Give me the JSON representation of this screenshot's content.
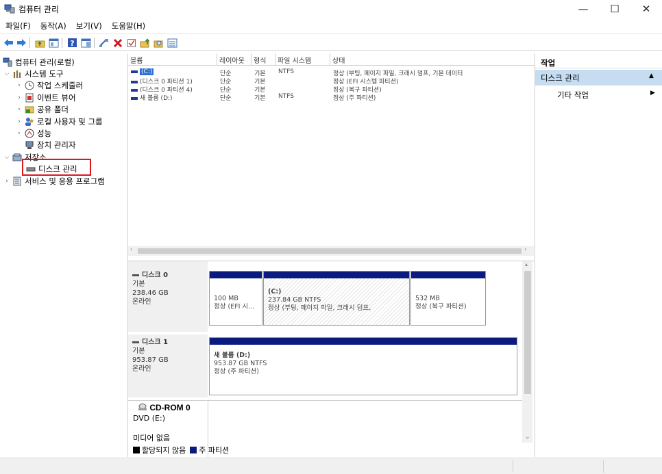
{
  "window": {
    "title": "컴퓨터 관리",
    "controls": {
      "minimize": "—",
      "maximize": "☐",
      "close": "✕"
    }
  },
  "menu": [
    "파일(F)",
    "동작(A)",
    "보기(V)",
    "도움말(H)"
  ],
  "tree": {
    "root": "컴퓨터 관리(로컬)",
    "system_tools": "시스템 도구",
    "task_scheduler": "작업 스케줄러",
    "event_viewer": "이벤트 뷰어",
    "shared_folders": "공유 폴더",
    "local_users": "로컬 사용자 및 그룹",
    "performance": "성능",
    "device_manager": "장치 관리자",
    "storage": "저장소",
    "disk_management": "디스크 관리",
    "services_apps": "서비스 및 응용 프로그램"
  },
  "volume_table": {
    "columns": [
      "볼륨",
      "레이아웃",
      "형식",
      "파일 시스템",
      "상태"
    ],
    "rows": [
      [
        "(C:)",
        "단순",
        "기본",
        "NTFS",
        "정상 (부팅, 페이지 파일, 크래시 덤프, 기본 데이터"
      ],
      [
        "(디스크 0 파티션 1)",
        "단순",
        "기본",
        "",
        "정상 (EFI 시스템 파티션)"
      ],
      [
        "(디스크 0 파티션 4)",
        "단순",
        "기본",
        "",
        "정상 (복구 파티션)"
      ],
      [
        "새 볼륨 (D:)",
        "단순",
        "기본",
        "NTFS",
        "정상 (주 파티션)"
      ]
    ]
  },
  "disks": {
    "disk0": {
      "name": "디스크 0",
      "type": "기본",
      "size": "238.46 GB",
      "status": "온라인",
      "partitions": [
        {
          "line1": "",
          "line2": "100 MB",
          "line3": "정상 (EFI 시..."
        },
        {
          "line1": "(C:)",
          "line2": "237.84 GB NTFS",
          "line3": "정상 (부팅, 페이지 파일, 크래시 덤프,"
        },
        {
          "line1": "",
          "line2": "532 MB",
          "line3": "정상 (복구 파티션)"
        }
      ]
    },
    "disk1": {
      "name": "디스크 1",
      "type": "기본",
      "size": "953.87 GB",
      "status": "온라인",
      "partition": {
        "line1": "새 볼륨 (D:)",
        "line2": "953.87 GB NTFS",
        "line3": "정상 (주 파티션)"
      }
    },
    "cdrom": {
      "name": "CD-ROM 0",
      "drive": "DVD (E:)",
      "media": "미디어 없음"
    }
  },
  "legend": {
    "unallocated": "할당되지 않음",
    "primary": "주 파티션"
  },
  "actions": {
    "title": "작업",
    "selected": "디스크 관리",
    "other": "기타 작업"
  },
  "colors": {
    "primary_partition": "#0a1a7e",
    "selection": "#c5dcf1",
    "highlight_box": "#e0141e"
  }
}
